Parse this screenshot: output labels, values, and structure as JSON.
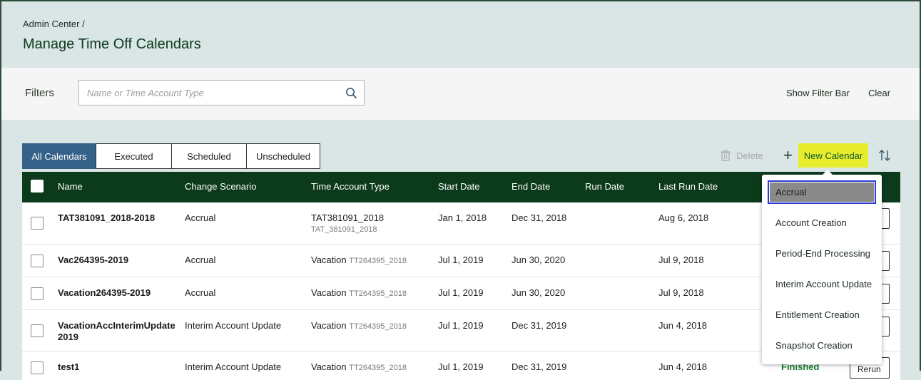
{
  "header": {
    "breadcrumb": "Admin Center /",
    "title": "Manage Time Off Calendars"
  },
  "filterbar": {
    "label": "Filters",
    "search_placeholder": "Name or Time Account Type",
    "show_filter_bar": "Show Filter Bar",
    "clear": "Clear"
  },
  "tabs": [
    {
      "label": "All Calendars",
      "active": true
    },
    {
      "label": "Executed",
      "active": false
    },
    {
      "label": "Scheduled",
      "active": false
    },
    {
      "label": "Unscheduled",
      "active": false
    }
  ],
  "toolbar": {
    "delete_label": "Delete",
    "new_calendar_label": "New Calendar"
  },
  "table": {
    "columns": [
      "Name",
      "Change Scenario",
      "Time Account Type",
      "Start Date",
      "End Date",
      "Run Date",
      "Last Run Date"
    ],
    "rows": [
      {
        "name": "TAT381091_2018-2018",
        "scenario": "Accrual",
        "account_type": "TAT381091_2018",
        "account_sub": "TAT_381091_2018",
        "start": "Jan 1, 2018",
        "end": "Dec 31, 2018",
        "run": "",
        "last_run": "Aug 6, 2018"
      },
      {
        "name": "Vac264395-2019",
        "scenario": "Accrual",
        "account_type": "Vacation",
        "account_sub": "TT264395_2018",
        "start": "Jul 1, 2019",
        "end": "Jun 30, 2020",
        "run": "",
        "last_run": "Jul 9, 2018"
      },
      {
        "name": "Vacation264395-2019",
        "scenario": "Accrual",
        "account_type": "Vacation",
        "account_sub": "TT264395_2018",
        "start": "Jul 1, 2019",
        "end": "Jun 30, 2020",
        "run": "",
        "last_run": "Jul 9, 2018"
      },
      {
        "name": "VacationAccInterimUpdate 2019",
        "scenario": "Interim Account Update",
        "account_type": "Vacation",
        "account_sub": "TT264395_2018",
        "start": "Jul 1, 2019",
        "end": "Dec 31, 2019",
        "run": "",
        "last_run": "Jun 4, 2018"
      },
      {
        "name": "test1",
        "scenario": "Interim Account Update",
        "account_type": "Vacation",
        "account_sub": "TT264395_2018",
        "start": "Jul 1, 2019",
        "end": "Dec 31, 2019",
        "run": "",
        "last_run": "Jun 4, 2018",
        "status": "Finished",
        "action": "Rerun"
      }
    ]
  },
  "dropdown": {
    "items": [
      "Accrual",
      "Account Creation",
      "Period-End Processing",
      "Interim Account Update",
      "Entitlement Creation",
      "Snapshot Creation"
    ],
    "selected": "Accrual"
  },
  "colors": {
    "header_bg": "#dae5e6",
    "table_header": "#0c3b1c",
    "active_tab": "#346187",
    "highlight": "#e7ed2d",
    "finished": "#1a7a2e"
  }
}
